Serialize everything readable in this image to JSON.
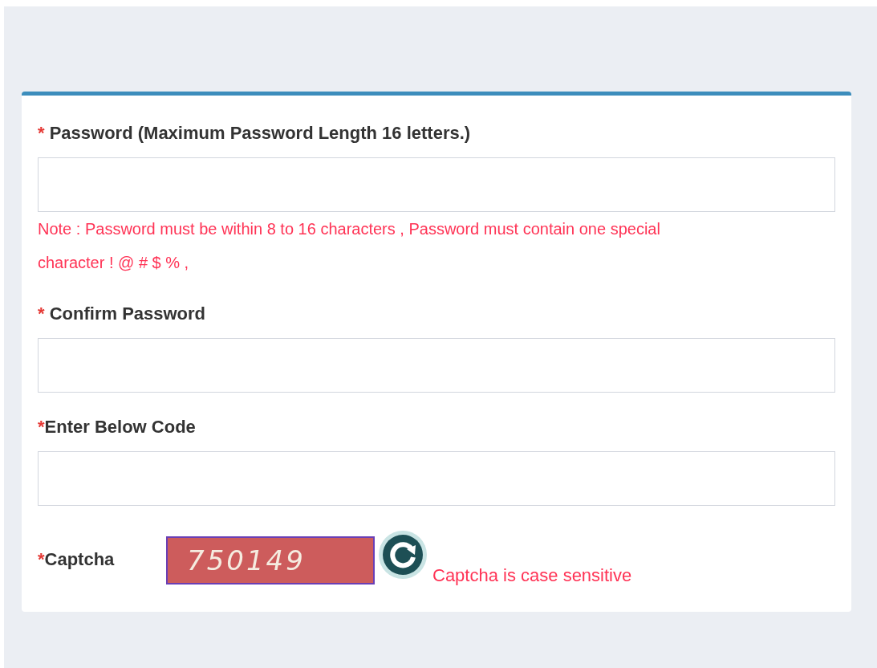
{
  "fields": [
    {
      "required_mark": "* ",
      "label": "Password (Maximum Password Length 16 letters.)",
      "note": "Note : Password must be within 8 to 16 characters , Password must contain one special character ! @ # $ % ,"
    },
    {
      "required_mark": "* ",
      "label": "Confirm Password"
    },
    {
      "required_mark": "*",
      "label": "Enter Below Code"
    }
  ],
  "captcha": {
    "required_mark": "*",
    "label": "Captcha",
    "code": "750149",
    "hint": "Captcha is case sensitive"
  }
}
